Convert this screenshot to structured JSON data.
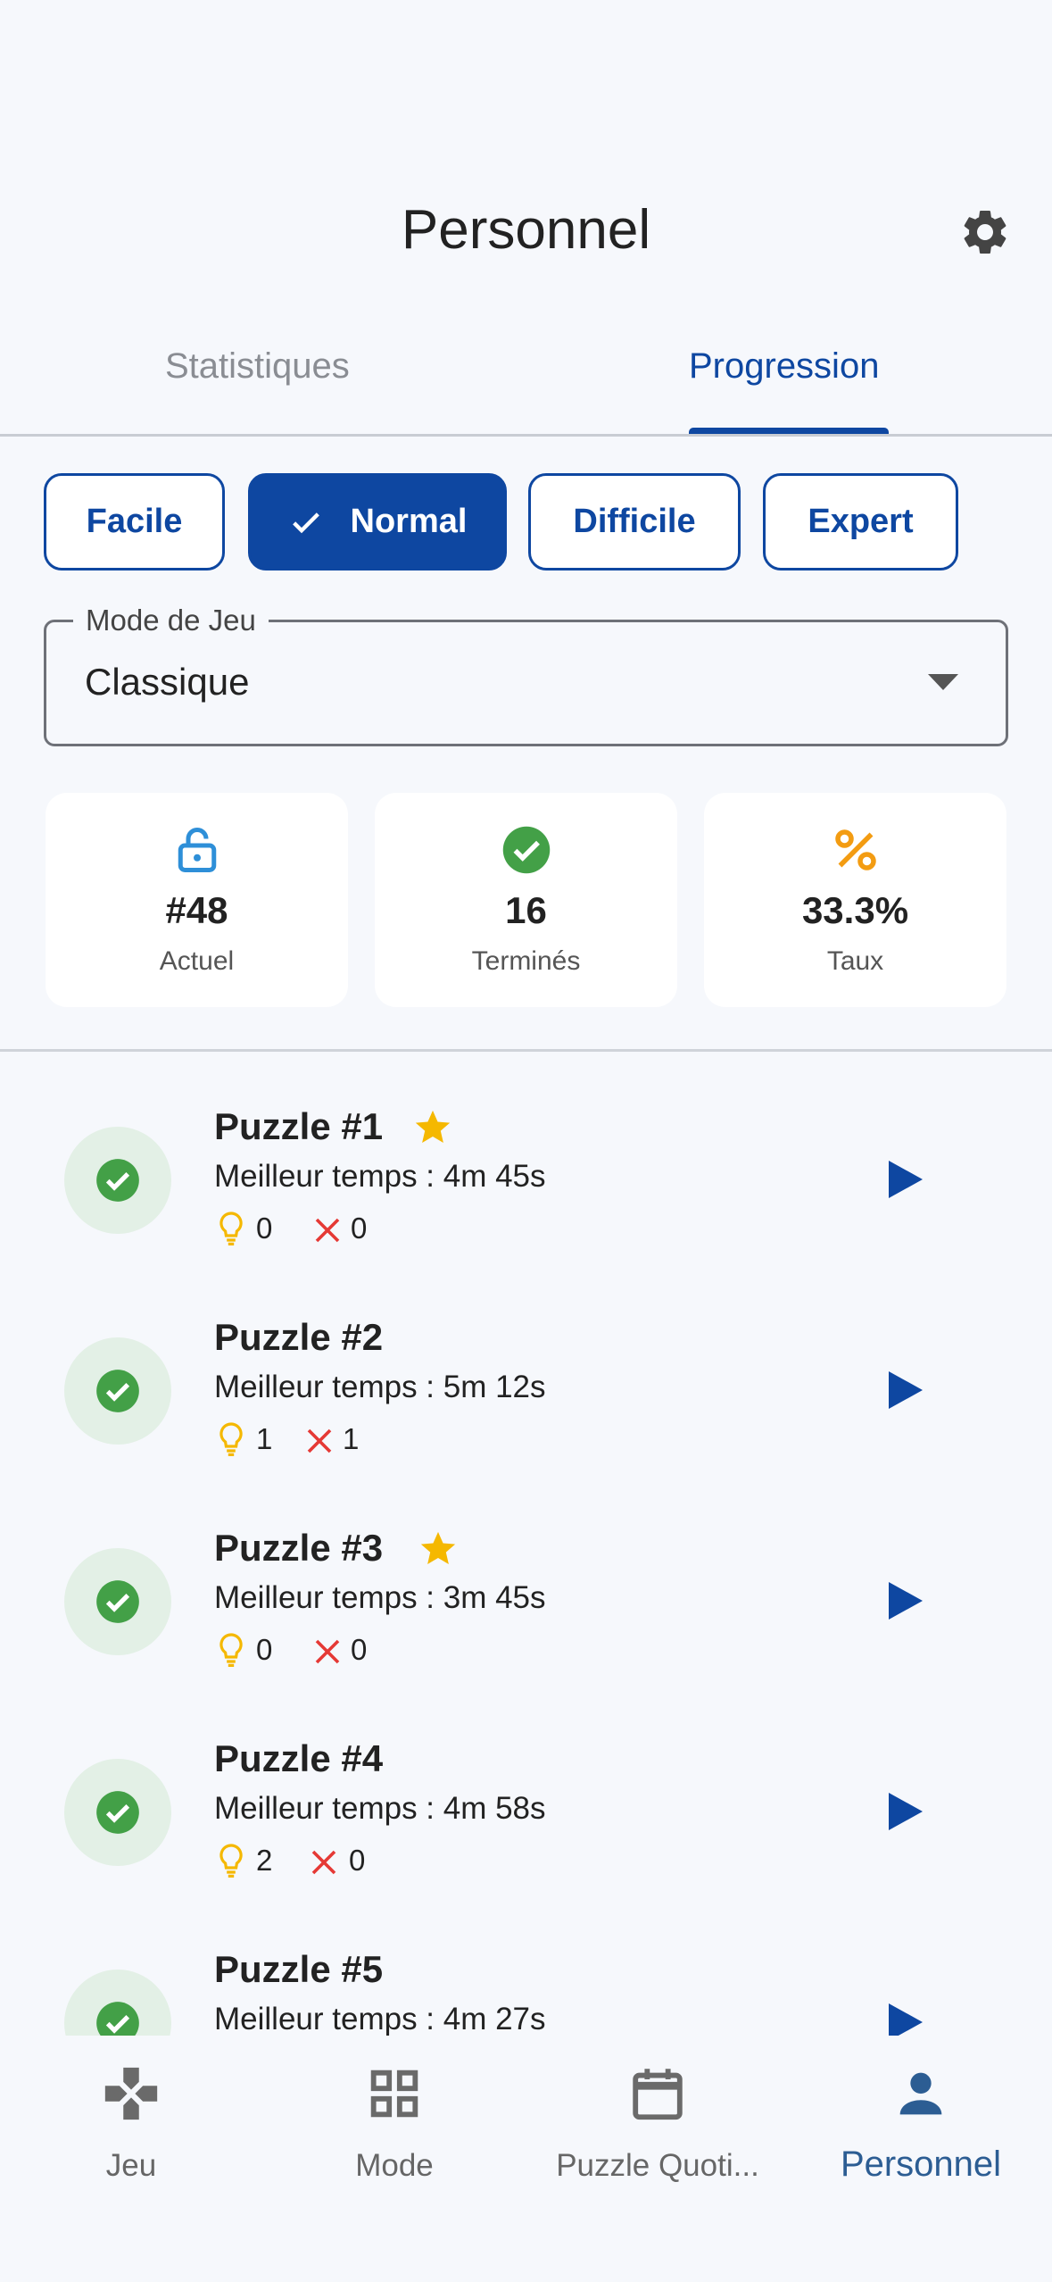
{
  "header": {
    "title": "Personnel"
  },
  "tabs": [
    {
      "label": "Statistiques"
    },
    {
      "label": "Progression"
    }
  ],
  "difficulty_chips": [
    {
      "label": "Facile"
    },
    {
      "label": "Normal"
    },
    {
      "label": "Difficile"
    },
    {
      "label": "Expert"
    }
  ],
  "selected_difficulty": "Normal",
  "mode_select": {
    "label": "Mode de Jeu",
    "value": "Classique"
  },
  "stats": [
    {
      "value": "#48",
      "label": "Actuel",
      "icon": "lock-open-icon",
      "color": "#2e8fd8"
    },
    {
      "value": "16",
      "label": "Terminés",
      "icon": "check-circle-icon",
      "color": "#43a047"
    },
    {
      "value": "33.3%",
      "label": "Taux",
      "icon": "percent-icon",
      "color": "#f39c12"
    }
  ],
  "puzzles": [
    {
      "name": "Puzzle #1",
      "best": "Meilleur temps : 4m 45s",
      "hints": "0",
      "errors": "0",
      "starred": true
    },
    {
      "name": "Puzzle #2",
      "best": "Meilleur temps : 5m 12s",
      "hints": "1",
      "errors": "1",
      "starred": false
    },
    {
      "name": "Puzzle #3",
      "best": "Meilleur temps : 3m 45s",
      "hints": "0",
      "errors": "0",
      "starred": true
    },
    {
      "name": "Puzzle #4",
      "best": "Meilleur temps : 4m 58s",
      "hints": "2",
      "errors": "0",
      "starred": false
    },
    {
      "name": "Puzzle #5",
      "best": "Meilleur temps : 4m 27s",
      "hints": "",
      "errors": "",
      "starred": false
    }
  ],
  "bottom_nav": [
    {
      "label": "Jeu",
      "icon": "gamepad-icon"
    },
    {
      "label": "Mode",
      "icon": "grid-icon"
    },
    {
      "label": "Puzzle Quoti...",
      "icon": "calendar-icon"
    },
    {
      "label": "Personnel",
      "icon": "person-icon"
    }
  ],
  "colors": {
    "accent": "#0e47a1",
    "success": "#43a047",
    "star": "#f5b800",
    "error": "#e53935",
    "hint": "#f5b800"
  }
}
